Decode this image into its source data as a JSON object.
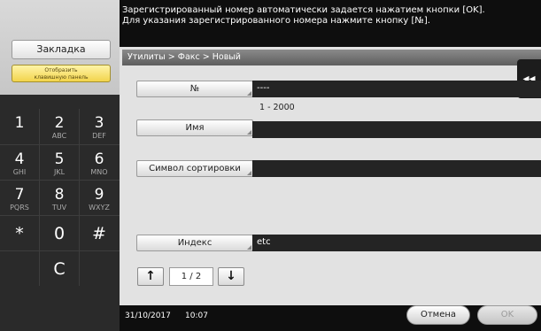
{
  "left_panel": {
    "bookmark_label": "Закладка",
    "keyboard_label_line1": "Отобразить",
    "keyboard_label_line2": "клавишную панель"
  },
  "keypad": {
    "keys": [
      {
        "digit": "1",
        "letters": ""
      },
      {
        "digit": "2",
        "letters": "ABC"
      },
      {
        "digit": "3",
        "letters": "DEF"
      },
      {
        "digit": "4",
        "letters": "GHI"
      },
      {
        "digit": "5",
        "letters": "JKL"
      },
      {
        "digit": "6",
        "letters": "MNO"
      },
      {
        "digit": "7",
        "letters": "PQRS"
      },
      {
        "digit": "8",
        "letters": "TUV"
      },
      {
        "digit": "9",
        "letters": "WXYZ"
      },
      {
        "digit": "*",
        "letters": ""
      },
      {
        "digit": "0",
        "letters": ""
      },
      {
        "digit": "#",
        "letters": ""
      }
    ],
    "clear_label": "C"
  },
  "message": {
    "line1": "Зарегистрированный номер автоматически задается нажатием кнопки [OK].",
    "line2": "Для указания зарегистрированного номера нажмите кнопку [№]."
  },
  "breadcrumb": "Утилиты > Факс > Новый",
  "side_tab_icon": "double-chevron-left-icon",
  "side_tab_glyph": "◂◂",
  "fields": {
    "number_label": "№",
    "number_value": "----",
    "number_range": "1 - 2000",
    "name_label": "Имя",
    "name_value": "",
    "sort_label": "Символ сортировки",
    "sort_value": "",
    "index_label": "Индекс",
    "index_value": "etc"
  },
  "pager": {
    "up_glyph": "↑",
    "down_glyph": "↓",
    "count": "1 / 2"
  },
  "footer": {
    "date": "31/10/2017",
    "time": "10:07",
    "cancel_label": "Отмена",
    "ok_label": "OK"
  }
}
